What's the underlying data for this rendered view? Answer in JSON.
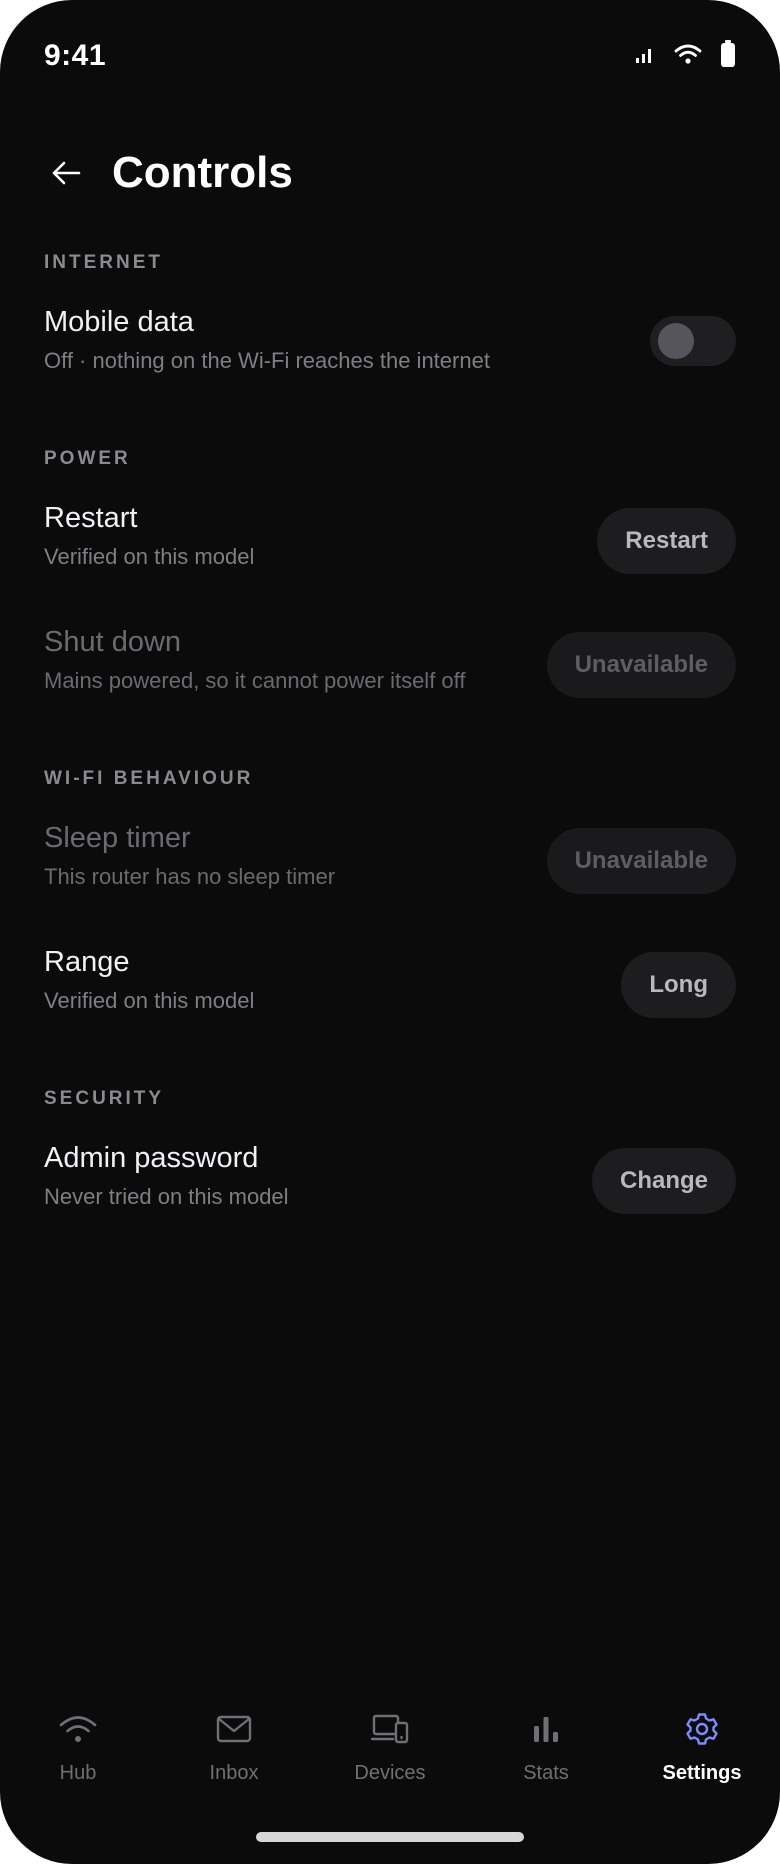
{
  "status_bar": {
    "time": "9:41"
  },
  "header": {
    "title": "Controls"
  },
  "sections": {
    "internet": {
      "label": "INTERNET",
      "mobile_data": {
        "title": "Mobile data",
        "subtitle": "Off · nothing on the Wi-Fi reaches the internet",
        "toggle_on": false
      }
    },
    "power": {
      "label": "POWER",
      "restart": {
        "title": "Restart",
        "subtitle": "Verified on this model",
        "button": "Restart"
      },
      "shutdown": {
        "title": "Shut down",
        "subtitle": "Mains powered, so it cannot power itself off",
        "button": "Unavailable"
      }
    },
    "wifi": {
      "label": "WI-FI BEHAVIOUR",
      "sleep_timer": {
        "title": "Sleep timer",
        "subtitle": "This router has no sleep timer",
        "button": "Unavailable"
      },
      "range": {
        "title": "Range",
        "subtitle": "Verified on this model",
        "button": "Long"
      }
    },
    "security": {
      "label": "SECURITY",
      "admin_password": {
        "title": "Admin password",
        "subtitle": "Never tried on this model",
        "button": "Change"
      }
    }
  },
  "tabs": {
    "hub": "Hub",
    "inbox": "Inbox",
    "devices": "Devices",
    "stats": "Stats",
    "settings": "Settings"
  },
  "colors": {
    "background": "#0b0b0c",
    "accent": "#7b8cff",
    "pill": "#1d1d20"
  }
}
